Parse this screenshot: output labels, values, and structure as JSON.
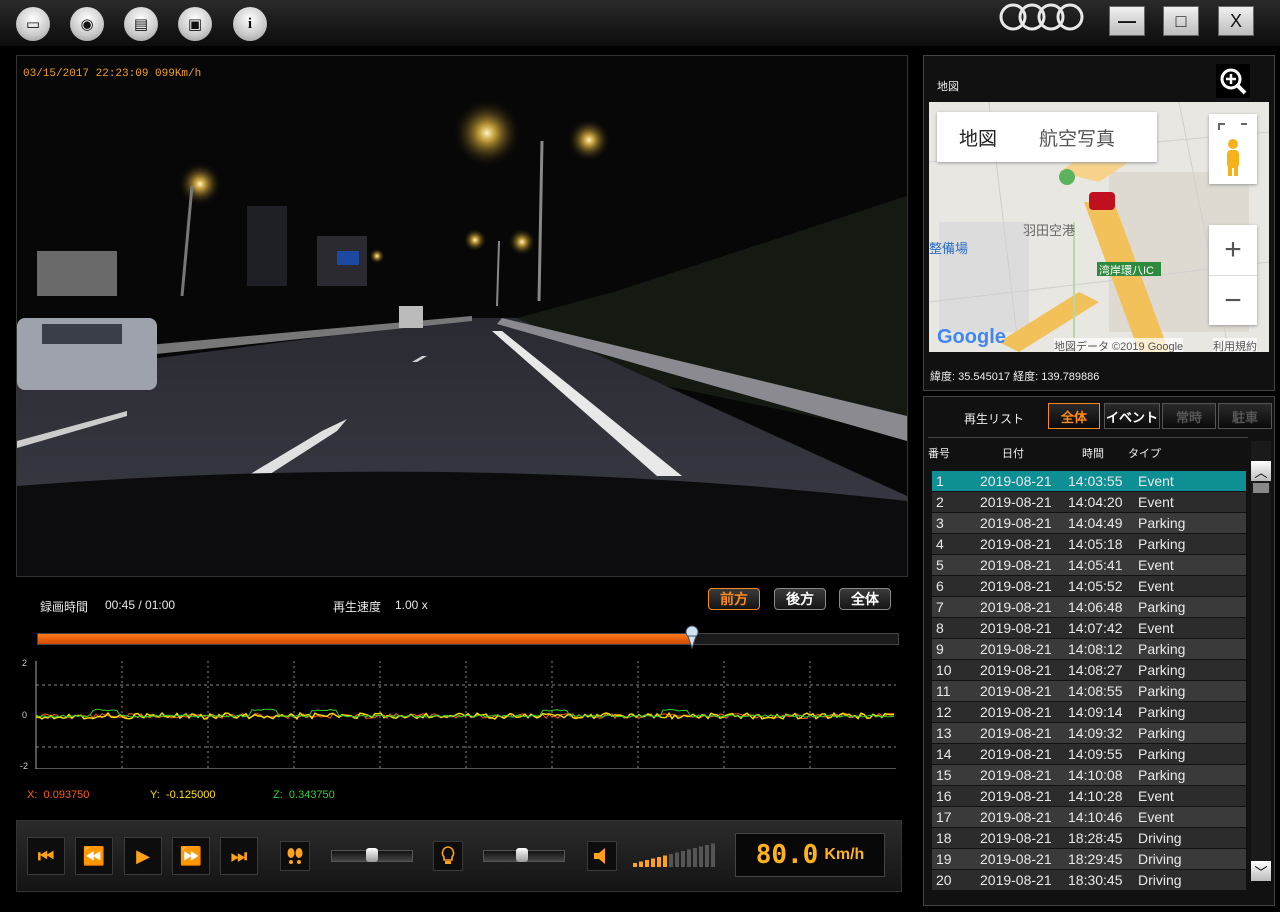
{
  "toolbar": {
    "icons": [
      "open-folder-icon",
      "camera-icon",
      "print-icon",
      "window-icon",
      "info-icon"
    ],
    "icon_glyphs": [
      "▭",
      "◉",
      "▤",
      "▣",
      "i"
    ],
    "window_controls": {
      "minimize": "—",
      "maximize": "□",
      "close": "X"
    }
  },
  "video": {
    "osd_text": "03/15/2017 22:23:09 099Km/h"
  },
  "playback": {
    "rec_time_label": "録画時間",
    "rec_time_value": "00:45 / 01:00",
    "speed_label": "再生速度",
    "speed_value": "1.00 x",
    "view_buttons": [
      "前方",
      "後方",
      "全体"
    ],
    "progress": 0.76
  },
  "graph": {
    "y_ticks": [
      "2",
      "0",
      "-2"
    ],
    "x_label": "X:",
    "x_value": "0.093750",
    "y_label": "Y:",
    "y_value": "-0.125000",
    "z_label": "Z:",
    "z_value": "0.343750",
    "colors": {
      "x": "#ff5a1a",
      "y": "#ffe000",
      "z": "#30d030"
    }
  },
  "controls": {
    "skip_start_glyph": "⏮",
    "rewind_glyph": "⏪",
    "play_glyph": "▶",
    "forward_glyph": "⏩",
    "skip_end_glyph": "⏭",
    "speed_display": "80.0",
    "speed_unit": "Km/h",
    "volume_level": 0.4,
    "accent": "#ffa21a"
  },
  "map": {
    "title": "地図",
    "tab_map": "地図",
    "tab_aerial": "航空写真",
    "place_airport": "羽田空港",
    "place_ramp": "整備場",
    "place_ic": "湾岸環八IC",
    "copyright": "地図データ ©2019 Google",
    "terms": "利用規約",
    "google": "Google",
    "latlng": "緯度: 35.545017 経度: 139.789886"
  },
  "playlist": {
    "title": "再生リスト",
    "filters": [
      "全体",
      "イベント",
      "常時",
      "駐車"
    ],
    "headers": [
      "番号",
      "日付",
      "時間",
      "タイプ"
    ],
    "rows": [
      {
        "no": "1",
        "date": "2019-08-21",
        "time": "14:03:55",
        "type": "Event"
      },
      {
        "no": "2",
        "date": "2019-08-21",
        "time": "14:04:20",
        "type": "Event"
      },
      {
        "no": "3",
        "date": "2019-08-21",
        "time": "14:04:49",
        "type": "Parking"
      },
      {
        "no": "4",
        "date": "2019-08-21",
        "time": "14:05:18",
        "type": "Parking"
      },
      {
        "no": "5",
        "date": "2019-08-21",
        "time": "14:05:41",
        "type": "Event"
      },
      {
        "no": "6",
        "date": "2019-08-21",
        "time": "14:05:52",
        "type": "Event"
      },
      {
        "no": "7",
        "date": "2019-08-21",
        "time": "14:06:48",
        "type": "Parking"
      },
      {
        "no": "8",
        "date": "2019-08-21",
        "time": "14:07:42",
        "type": "Event"
      },
      {
        "no": "9",
        "date": "2019-08-21",
        "time": "14:08:12",
        "type": "Parking"
      },
      {
        "no": "10",
        "date": "2019-08-21",
        "time": "14:08:27",
        "type": "Parking"
      },
      {
        "no": "11",
        "date": "2019-08-21",
        "time": "14:08:55",
        "type": "Parking"
      },
      {
        "no": "12",
        "date": "2019-08-21",
        "time": "14:09:14",
        "type": "Parking"
      },
      {
        "no": "13",
        "date": "2019-08-21",
        "time": "14:09:32",
        "type": "Parking"
      },
      {
        "no": "14",
        "date": "2019-08-21",
        "time": "14:09:55",
        "type": "Parking"
      },
      {
        "no": "15",
        "date": "2019-08-21",
        "time": "14:10:08",
        "type": "Parking"
      },
      {
        "no": "16",
        "date": "2019-08-21",
        "time": "14:10:28",
        "type": "Event"
      },
      {
        "no": "17",
        "date": "2019-08-21",
        "time": "14:10:46",
        "type": "Event"
      },
      {
        "no": "18",
        "date": "2019-08-21",
        "time": "18:28:45",
        "type": "Driving"
      },
      {
        "no": "19",
        "date": "2019-08-21",
        "time": "18:29:45",
        "type": "Driving"
      },
      {
        "no": "20",
        "date": "2019-08-21",
        "time": "18:30:45",
        "type": "Driving"
      }
    ],
    "selected_color": "#0e8f94"
  }
}
